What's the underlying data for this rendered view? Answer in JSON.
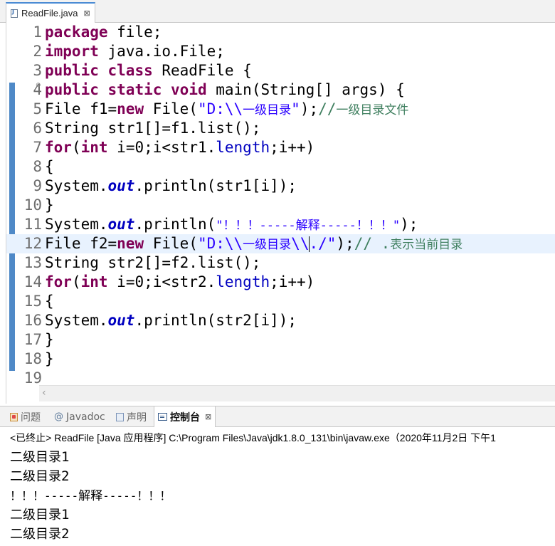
{
  "editor_tab": {
    "label": "ReadFile.java",
    "close": "⊠"
  },
  "code_lines": [
    {
      "n": "1"
    },
    {
      "n": "2"
    },
    {
      "n": "3"
    },
    {
      "n": "4"
    },
    {
      "n": "5"
    },
    {
      "n": "6"
    },
    {
      "n": "7"
    },
    {
      "n": "8"
    },
    {
      "n": "9"
    },
    {
      "n": "10"
    },
    {
      "n": "11"
    },
    {
      "n": "12"
    },
    {
      "n": "13"
    },
    {
      "n": "14"
    },
    {
      "n": "15"
    },
    {
      "n": "16"
    },
    {
      "n": "17"
    },
    {
      "n": "18"
    },
    {
      "n": "19"
    }
  ],
  "code": {
    "l1": {
      "kw": "package",
      "rest": " file;"
    },
    "l2": {
      "kw": "import",
      "rest": " java.io.File;"
    },
    "l3": {
      "kw1": "public",
      "kw2": "class",
      "rest": " ReadFile {"
    },
    "l4": {
      "kw1": "public",
      "kw2": "static",
      "kw3": "void",
      "rest": " main(String[] args) {"
    },
    "l5": {
      "a": "File f1=",
      "kw": "new",
      "b": " File(",
      "s1": "\"D:\\\\",
      "s2": "一级目录",
      "s3": "\"",
      "c": ");",
      "cm1": "//",
      "cm2": "一级目录文件"
    },
    "l6": {
      "a": "String str1[]=f1.list();"
    },
    "l7": {
      "kw1": "for",
      "a": "(",
      "kw2": "int",
      "b": " i=0;i<str1.",
      "f": "length",
      "c": ";i++)"
    },
    "l8": {
      "a": "{"
    },
    "l9": {
      "a": "System.",
      "f": "out",
      "b": ".println(str1[i]);"
    },
    "l10": {
      "a": "}"
    },
    "l11": {
      "a": "System.",
      "f": "out",
      "b": ".println(",
      "s1": "\"！！！-----",
      "s2": "解释",
      "s3": "-----！！！\"",
      "c": ");"
    },
    "l12": {
      "a": "File f2=",
      "kw": "new",
      "b": " File(",
      "s1": "\"D:\\\\",
      "s2": "一级目录",
      "s3": "\\\\",
      "s4": "./\"",
      "c": ");",
      "cm1": "// .",
      "cm2": "表示当前目录"
    },
    "l13": {
      "a": "String str2[]=f2.list();"
    },
    "l14": {
      "kw1": "for",
      "a": "(",
      "kw2": "int",
      "b": " i=0;i<str2.",
      "f": "length",
      "c": ";i++)"
    },
    "l15": {
      "a": "{"
    },
    "l16": {
      "a": "System.",
      "f": "out",
      "b": ".println(str2[i]);"
    },
    "l17": {
      "a": "}"
    },
    "l18": {
      "a": "}"
    }
  },
  "console_tabs": {
    "problems": "问题",
    "javadoc": "Javadoc",
    "declaration": "声明",
    "console": "控制台",
    "console_close": "⊠",
    "javadoc_icon": "@"
  },
  "console": {
    "status": "<已终止> ReadFile [Java 应用程序] C:\\Program Files\\Java\\jdk1.8.0_131\\bin\\javaw.exe（2020年11月2日 下午1",
    "output": [
      {
        "cjk": "二级目录",
        "num": "1"
      },
      {
        "cjk": "二级目录",
        "num": "2"
      },
      {
        "pre": "！！！-----",
        "cjk": "解释",
        "post": "-----！！！"
      },
      {
        "cjk": "二级目录",
        "num": "1"
      },
      {
        "cjk": "二级目录",
        "num": "2"
      }
    ]
  },
  "colors": {
    "keyword": "#7f0055",
    "string": "#2a00ff",
    "comment": "#3f7f5f",
    "field": "#0000c0",
    "current_line": "#e8f2fe",
    "gutter_mark": "#4f89c7"
  },
  "icons": {
    "file": "java-file-icon",
    "problems": "problems-icon",
    "javadoc": "javadoc-icon",
    "declaration": "declaration-icon",
    "console": "console-icon",
    "scroll_left": "chevron-left-icon"
  }
}
